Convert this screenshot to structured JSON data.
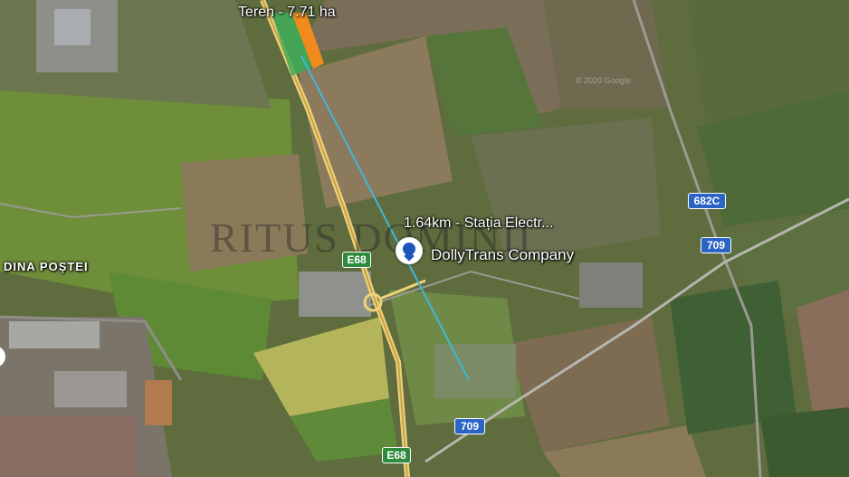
{
  "map": {
    "parcel_label": "Teren - 7.71 ha",
    "distance_label": "1.64km - Stația Electr...",
    "poi_label": "DollyTrans Company",
    "district_label": "DINA POȘTEI",
    "watermark": "RITUS DOMINII",
    "imagery_credit": "© 2020 Google",
    "road_shields": [
      {
        "id": "e68-north",
        "label": "E68",
        "style": "green"
      },
      {
        "id": "e68-south",
        "label": "E68",
        "style": "green"
      },
      {
        "id": "709-east",
        "label": "709",
        "style": "blue"
      },
      {
        "id": "709-south",
        "label": "709",
        "style": "blue"
      },
      {
        "id": "682c",
        "label": "682C",
        "style": "blue"
      }
    ],
    "colors": {
      "parcel_fill": "#3fae58",
      "parcel_edge": "#f08a1c",
      "measure_line": "#3fb8d8",
      "highway": "#e9c86a",
      "poi_pin": "#1c56b8"
    }
  }
}
